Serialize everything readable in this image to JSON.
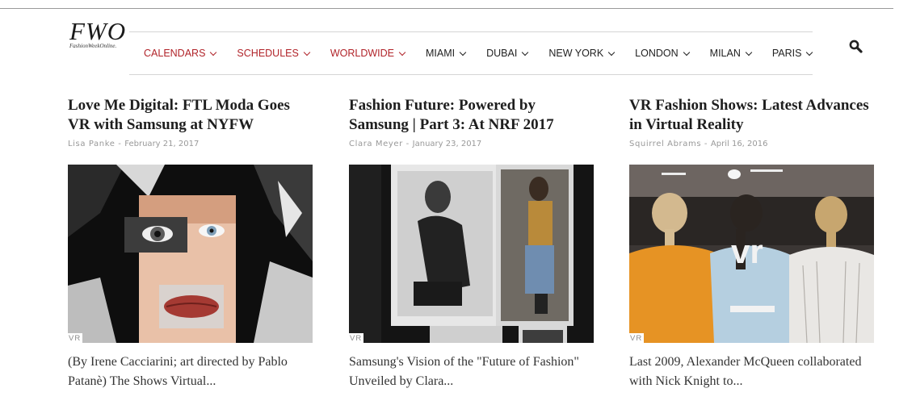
{
  "logo": {
    "mark": "FWO",
    "tagline": "FashionWeekOnline."
  },
  "nav": [
    {
      "label": "CALENDARS",
      "accent": true
    },
    {
      "label": "SCHEDULES",
      "accent": true
    },
    {
      "label": "WORLDWIDE",
      "accent": true
    },
    {
      "label": "MIAMI",
      "accent": false
    },
    {
      "label": "DUBAI",
      "accent": false
    },
    {
      "label": "NEW YORK",
      "accent": false
    },
    {
      "label": "LONDON",
      "accent": false
    },
    {
      "label": "MILAN",
      "accent": false
    },
    {
      "label": "PARIS",
      "accent": false
    }
  ],
  "colors": {
    "accent": "#b1242a",
    "text": "#222222",
    "meta": "#999999"
  },
  "search": {
    "icon": "search-icon"
  },
  "articles": [
    {
      "title": "Love Me Digital: FTL Moda Goes VR with Samsung at NYFW",
      "author": "Lisa Panke",
      "date": "February 21, 2017",
      "tag": "VR",
      "excerpt": "(By Irene Cacciarini; art directed by Pablo Patanè) The Shows Virtual..."
    },
    {
      "title": "Fashion Future: Powered by Samsung | Part 3: At NRF 2017",
      "author": "Clara Meyer",
      "date": "January 23, 2017",
      "tag": "VR",
      "excerpt": "Samsung's Vision of the \"Future of Fashion\" Unveiled by Clara..."
    },
    {
      "title": "VR Fashion Shows: Latest Advances in Virtual Reality",
      "author": "Squirrel Abrams",
      "date": "April 16, 2016",
      "tag": "VR",
      "excerpt": "Last 2009, Alexander McQueen collaborated with Nick Knight to..."
    }
  ],
  "image_text": {
    "vr_overlay": "vr"
  }
}
